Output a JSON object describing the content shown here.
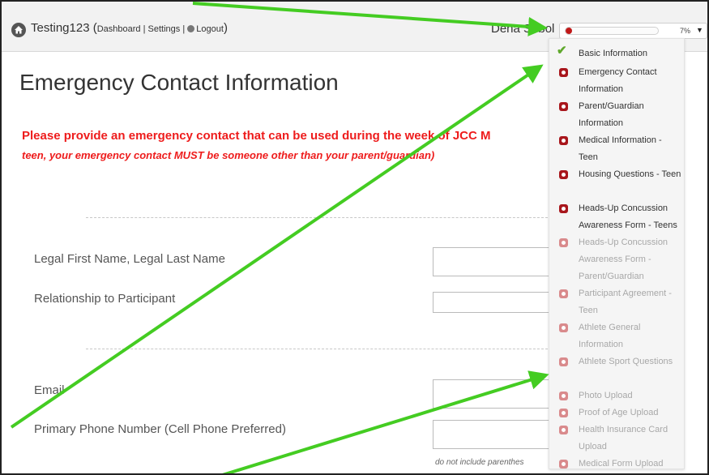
{
  "header": {
    "app_name": "Testing123",
    "nav_open": "(",
    "dashboard_label": "Dashboard",
    "sep1": " | ",
    "settings_label": "Settings",
    "sep2": " | ",
    "logout_label": "Logout",
    "nav_close": ")",
    "user_name": "Dena Sobol",
    "progress": {
      "percent_label": "7%",
      "fraction": 0.07,
      "caret": "▼"
    }
  },
  "page": {
    "title": "Emergency Contact Information",
    "notice_main": "Please provide an emergency contact that can be used during the week of JCC M",
    "notice_sub": "teen, your emergency contact MUST be someone other than your parent/guardian)"
  },
  "fields": {
    "name_label": "Legal First Name, Legal Last Name",
    "relationship_label": "Relationship to Participant",
    "email_label": "Email",
    "phone_label": "Primary Phone Number (Cell Phone Preferred)",
    "phone_hint": "do not include parenthes"
  },
  "menu": [
    {
      "label": "Basic Information",
      "status": "complete"
    },
    {
      "label": "Emergency Contact Information",
      "status": "active"
    },
    {
      "label": "Parent/Guardian Information",
      "status": "active"
    },
    {
      "label": "Medical Information - Teen",
      "status": "active"
    },
    {
      "label": "Housing Questions - Teen",
      "status": "active"
    },
    {
      "label": "Heads-Up Concussion Awareness Form - Teens",
      "status": "active"
    },
    {
      "label": "Heads-Up Concussion Awareness Form - Parent/Guardian",
      "status": "inactive"
    },
    {
      "label": "Participant Agreement - Teen",
      "status": "inactive"
    },
    {
      "label": "Athlete General Information",
      "status": "inactive"
    },
    {
      "label": "Athlete Sport Questions",
      "status": "inactive"
    },
    {
      "label": "Photo Upload",
      "status": "inactive"
    },
    {
      "label": "Proof of Age Upload",
      "status": "inactive"
    },
    {
      "label": "Health Insurance Card Upload",
      "status": "inactive"
    },
    {
      "label": "Medical Form Upload",
      "status": "inactive"
    }
  ],
  "colors": {
    "arrow": "#44cc22",
    "notice": "#ee1c1c",
    "progress_fill": "#c01818"
  }
}
